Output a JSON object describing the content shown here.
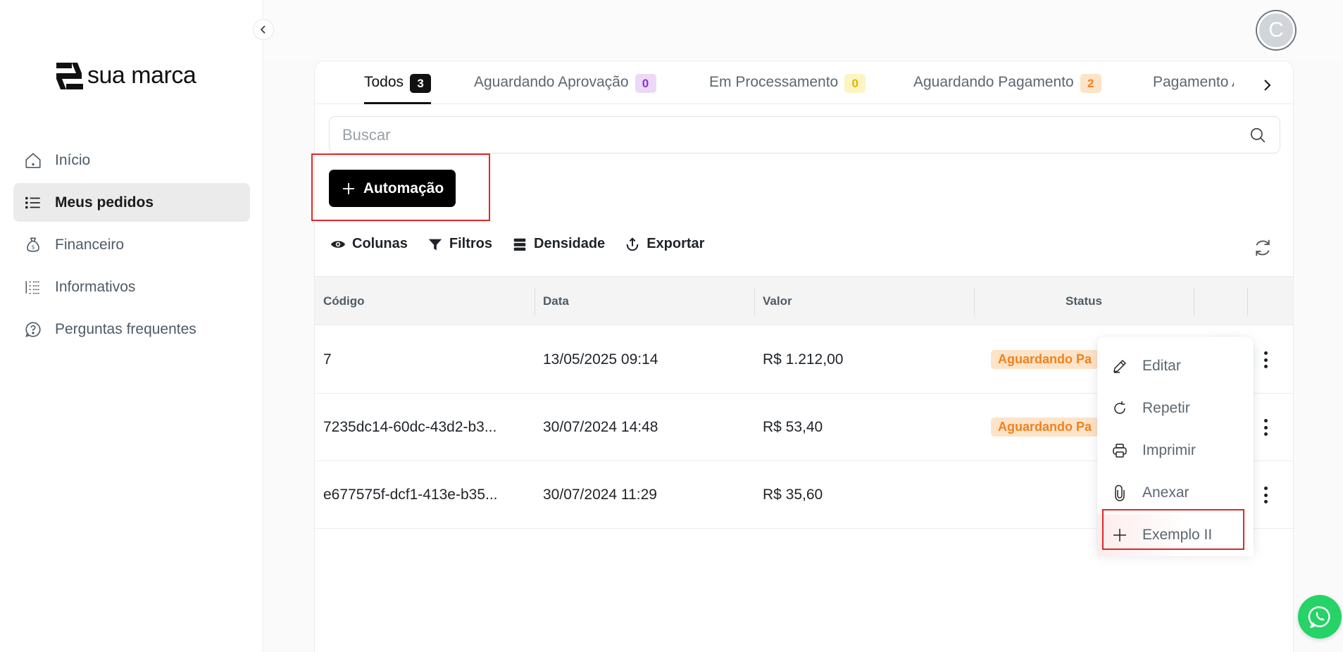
{
  "brand": {
    "name": "sua marca"
  },
  "sidebar": {
    "items": [
      {
        "label": "Início",
        "icon": "home-icon"
      },
      {
        "label": "Meus pedidos",
        "icon": "list-icon",
        "active": true
      },
      {
        "label": "Financeiro",
        "icon": "money-bag-icon"
      },
      {
        "label": "Informativos",
        "icon": "bar-list-icon"
      },
      {
        "label": "Perguntas frequentes",
        "icon": "question-icon"
      }
    ]
  },
  "header": {
    "avatar_initial": "C"
  },
  "tabs": [
    {
      "label": "Todos",
      "count": "3",
      "active": true
    },
    {
      "label": "Aguardando Aprovação",
      "count": "0"
    },
    {
      "label": "Em Processamento",
      "count": "0"
    },
    {
      "label": "Aguardando Pagamento",
      "count": "2"
    },
    {
      "label": "Pagamento A"
    }
  ],
  "search": {
    "placeholder": "Buscar"
  },
  "actions": {
    "automation_label": "Automação"
  },
  "toolbar": {
    "columns_label": "Colunas",
    "filters_label": "Filtros",
    "density_label": "Densidade",
    "export_label": "Exportar"
  },
  "table": {
    "headers": {
      "code": "Código",
      "date": "Data",
      "value": "Valor",
      "status": "Status"
    },
    "rows": [
      {
        "code": "7",
        "date": "13/05/2025 09:14",
        "value": "R$ 1.212,00",
        "status": "Aguardando Pa"
      },
      {
        "code": "7235dc14-60dc-43d2-b3...",
        "date": "30/07/2024 14:48",
        "value": "R$ 53,40",
        "status": "Aguardando Pa"
      },
      {
        "code": "e677575f-dcf1-413e-b35...",
        "date": "30/07/2024 11:29",
        "value": "R$ 35,60",
        "status": ""
      }
    ]
  },
  "context_menu": {
    "items": [
      {
        "label": "Editar",
        "icon": "pencil-icon"
      },
      {
        "label": "Repetir",
        "icon": "repeat-icon"
      },
      {
        "label": "Imprimir",
        "icon": "printer-icon"
      },
      {
        "label": "Anexar",
        "icon": "paperclip-icon"
      },
      {
        "label": "Exemplo II",
        "icon": "plus-icon"
      }
    ]
  },
  "colors": {
    "accent": "#000000",
    "highlight_border": "#e0262a",
    "status_badge_bg": "#fde3c8",
    "status_badge_text": "#f0821e",
    "whatsapp": "#25d366"
  }
}
